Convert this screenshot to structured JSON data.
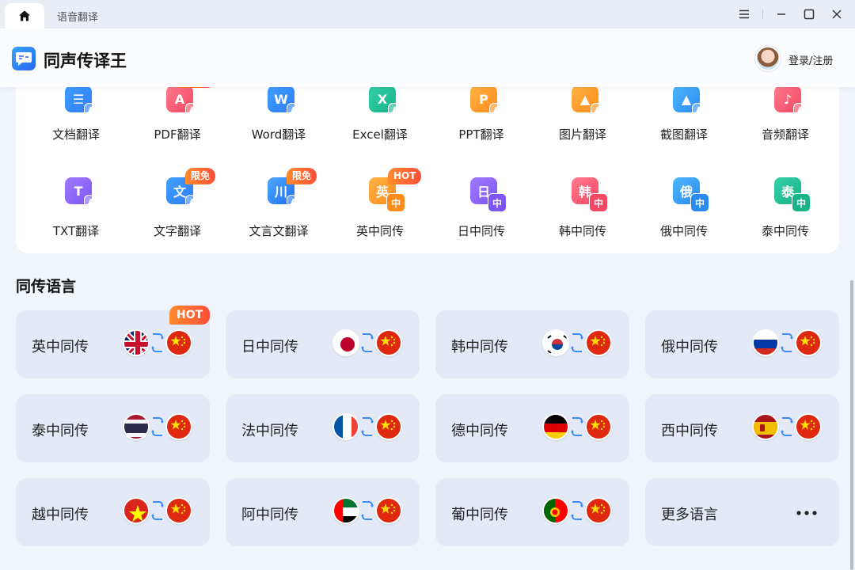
{
  "titlebar": {
    "tab_label": "语音翻译"
  },
  "header": {
    "app_title": "同声传译王",
    "login_label": "登录/注册"
  },
  "tools": [
    {
      "label": "文档翻译",
      "icon": "document-icon",
      "glyph": "☰",
      "badge": ""
    },
    {
      "label": "PDF翻译",
      "icon": "pdf-icon",
      "glyph": "A",
      "badge": ""
    },
    {
      "label": "Word翻译",
      "icon": "word-icon",
      "glyph": "W",
      "badge": ""
    },
    {
      "label": "Excel翻译",
      "icon": "excel-icon",
      "glyph": "X",
      "badge": ""
    },
    {
      "label": "PPT翻译",
      "icon": "ppt-icon",
      "glyph": "P",
      "badge": ""
    },
    {
      "label": "图片翻译",
      "icon": "image-icon",
      "glyph": "▲",
      "badge": ""
    },
    {
      "label": "截图翻译",
      "icon": "screenshot-icon",
      "glyph": "▲",
      "badge": ""
    },
    {
      "label": "音频翻译",
      "icon": "audio-icon",
      "glyph": "♪",
      "badge": ""
    },
    {
      "label": "TXT翻译",
      "icon": "txt-icon",
      "glyph": "T",
      "badge": ""
    },
    {
      "label": "文字翻译",
      "icon": "text-icon",
      "glyph": "文",
      "badge": "限免"
    },
    {
      "label": "文言文翻译",
      "icon": "scroll-icon",
      "glyph": "川",
      "badge": "限免"
    },
    {
      "label": "英中同传",
      "icon": "en-zh-icon",
      "glyph": "英",
      "badge": "HOT"
    },
    {
      "label": "日中同传",
      "icon": "ja-zh-icon",
      "glyph": "日",
      "badge": ""
    },
    {
      "label": "韩中同传",
      "icon": "ko-zh-icon",
      "glyph": "韩",
      "badge": ""
    },
    {
      "label": "俄中同传",
      "icon": "ru-zh-icon",
      "glyph": "俄",
      "badge": ""
    },
    {
      "label": "泰中同传",
      "icon": "th-zh-icon",
      "glyph": "泰",
      "badge": ""
    }
  ],
  "section_title": "同传语言",
  "hot_badge": "HOT",
  "languages": [
    {
      "label": "英中同传",
      "flag": "uk-flag-icon"
    },
    {
      "label": "日中同传",
      "flag": "japan-flag-icon"
    },
    {
      "label": "韩中同传",
      "flag": "korea-flag-icon"
    },
    {
      "label": "俄中同传",
      "flag": "russia-flag-icon"
    },
    {
      "label": "泰中同传",
      "flag": "thailand-flag-icon"
    },
    {
      "label": "法中同传",
      "flag": "france-flag-icon"
    },
    {
      "label": "德中同传",
      "flag": "germany-flag-icon"
    },
    {
      "label": "西中同传",
      "flag": "spain-flag-icon"
    },
    {
      "label": "越中同传",
      "flag": "vietnam-flag-icon"
    },
    {
      "label": "阿中同传",
      "flag": "uae-flag-icon"
    },
    {
      "label": "葡中同传",
      "flag": "portugal-flag-icon"
    }
  ],
  "more_languages": "更多语言",
  "colors": {
    "accent": "#2a66f0",
    "badge": "#ff5a35",
    "card_bg": "#e3e9f6",
    "page_bg": "#f0f4fb"
  }
}
